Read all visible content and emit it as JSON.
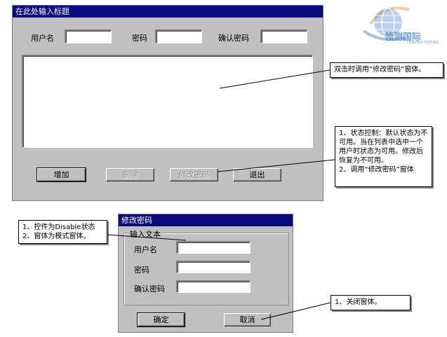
{
  "main_window": {
    "title": "在此处输入标题",
    "username_label": "用户名",
    "password_label": "密码",
    "confirm_label": "确认密码",
    "buttons": {
      "add": "增加",
      "delete": "删除",
      "change_password": "修改密码",
      "exit": "退出"
    }
  },
  "dialog": {
    "title": "修改密码",
    "group_label": "输入文本",
    "username_label": "用户名",
    "password_label": "密码",
    "confirm_label": "确认密码",
    "ok": "确定",
    "cancel": "取消"
  },
  "callouts": {
    "list": "双击时调用“修改密码”窗体。",
    "buttons": [
      "1、状态控制：默认状态为不可用。当在列表中选中一个用户时状态为可用。修改后恢复为不可用。",
      "2、调用“修改密码”窗体"
    ],
    "dialog": [
      "1、控件为Disable状态",
      "2、窗体为模式窗体。"
    ],
    "cancel": "1、关闭窗体。"
  },
  "logo": {
    "name": "领测国际",
    "subtitle": "LEADING TESTING"
  },
  "colors": {
    "titlebar": "#0a0a80",
    "window": "#c0c0c0",
    "logo_blue": "#3a78c8",
    "logo_orange": "#f0a040"
  }
}
